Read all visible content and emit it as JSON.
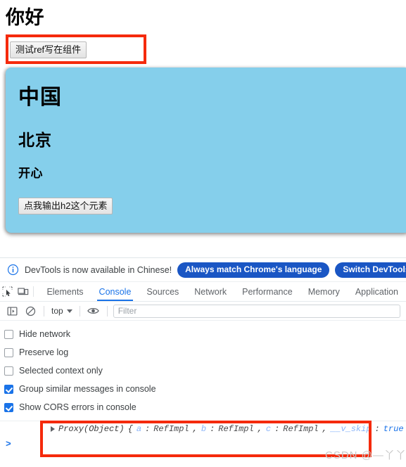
{
  "page": {
    "title": "你好",
    "top_button_label": "测试ref写在组件",
    "card": {
      "heading1": "中国",
      "heading2": "北京",
      "heading3": "开心",
      "button_label": "点我输出h2这个元素",
      "background_color": "#85cfeb"
    },
    "annotation_color": "#f52a0c"
  },
  "devtools": {
    "notification": {
      "icon": "info-circle-icon",
      "text": "DevTools is now available in Chinese!",
      "buttons": [
        {
          "label": "Always match Chrome's language"
        },
        {
          "label": "Switch DevTools to Chinese"
        }
      ],
      "button_color": "#1a56c4"
    },
    "toolbar_icons": [
      {
        "name": "inspect-element-icon"
      },
      {
        "name": "device-toolbar-icon"
      }
    ],
    "tabs": [
      {
        "label": "Elements",
        "active": false
      },
      {
        "label": "Console",
        "active": true
      },
      {
        "label": "Sources",
        "active": false
      },
      {
        "label": "Network",
        "active": false
      },
      {
        "label": "Performance",
        "active": false
      },
      {
        "label": "Memory",
        "active": false
      },
      {
        "label": "Application",
        "active": false
      }
    ],
    "active_tab_color": "#1a73e8",
    "console_toolbar": {
      "sidebar_icon": "console-sidebar-icon",
      "clear_icon": "clear-console-icon",
      "context": "top",
      "eye_icon": "live-expression-eye-icon",
      "filter_placeholder": "Filter",
      "filter_value": ""
    },
    "settings": [
      {
        "label": "Hide network",
        "checked": false
      },
      {
        "label": "Preserve log",
        "checked": false
      },
      {
        "label": "Selected context only",
        "checked": false
      },
      {
        "label": "Group similar messages in console",
        "checked": true
      },
      {
        "label": "Show CORS errors in console",
        "checked": true
      }
    ],
    "checkbox_checked_color": "#1a73e8",
    "console_log": {
      "disclosure": "expand-triangle-icon",
      "constructor": "Proxy(Object)",
      "open_brace": "{",
      "entries": [
        {
          "key": "a",
          "value": "RefImpl",
          "type": "object"
        },
        {
          "key": "b",
          "value": "RefImpl",
          "type": "object"
        },
        {
          "key": "c",
          "value": "RefImpl",
          "type": "object"
        },
        {
          "key": "__v_skip",
          "value": "true",
          "type": "boolean"
        }
      ],
      "close_brace": "}",
      "separator": ", ",
      "colon": ": "
    },
    "prompt": ">",
    "watermark": "CSDN @—丫丫"
  }
}
